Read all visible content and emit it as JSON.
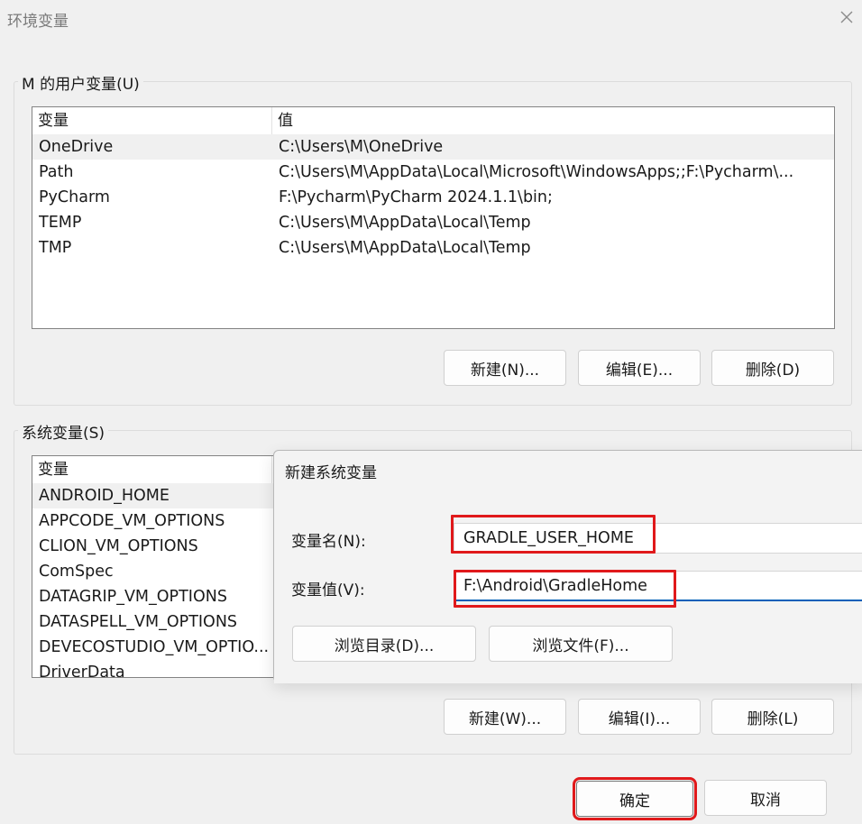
{
  "window": {
    "title": "环境变量"
  },
  "user_vars": {
    "group_label": "M 的用户变量(U)",
    "columns": [
      "变量",
      "值"
    ],
    "rows": [
      {
        "name": "OneDrive",
        "value": "C:\\Users\\M\\OneDrive",
        "selected": true
      },
      {
        "name": "Path",
        "value": "C:\\Users\\M\\AppData\\Local\\Microsoft\\WindowsApps;;F:\\Pycharm\\...",
        "selected": false
      },
      {
        "name": "PyCharm",
        "value": "F:\\Pycharm\\PyCharm 2024.1.1\\bin;",
        "selected": false
      },
      {
        "name": "TEMP",
        "value": "C:\\Users\\M\\AppData\\Local\\Temp",
        "selected": false
      },
      {
        "name": "TMP",
        "value": "C:\\Users\\M\\AppData\\Local\\Temp",
        "selected": false
      }
    ],
    "buttons": {
      "new": "新建(N)...",
      "edit": "编辑(E)...",
      "delete": "删除(D)"
    }
  },
  "system_vars": {
    "group_label": "系统变量(S)",
    "columns": [
      "变量"
    ],
    "rows": [
      {
        "name": "ANDROID_HOME",
        "selected": true
      },
      {
        "name": "APPCODE_VM_OPTIONS",
        "selected": false
      },
      {
        "name": "CLION_VM_OPTIONS",
        "selected": false
      },
      {
        "name": "ComSpec",
        "selected": false
      },
      {
        "name": "DATAGRIP_VM_OPTIONS",
        "selected": false
      },
      {
        "name": "DATASPELL_VM_OPTIONS",
        "selected": false
      },
      {
        "name": "DEVECOSTUDIO_VM_OPTIO...",
        "selected": false
      },
      {
        "name": "DriverData",
        "selected": false
      }
    ],
    "buttons": {
      "new": "新建(W)...",
      "edit": "编辑(I)...",
      "delete": "删除(L)"
    }
  },
  "dialog": {
    "title": "新建系统变量",
    "name_label": "变量名(N):",
    "name_value": "GRADLE_USER_HOME",
    "value_label": "变量值(V):",
    "value_value": "F:\\Android\\GradleHome",
    "browse_dir": "浏览目录(D)...",
    "browse_file": "浏览文件(F)..."
  },
  "footer": {
    "ok": "确定",
    "cancel": "取消"
  },
  "colors": {
    "highlight_red": "#e0191b",
    "focus_blue": "#005fb8"
  }
}
